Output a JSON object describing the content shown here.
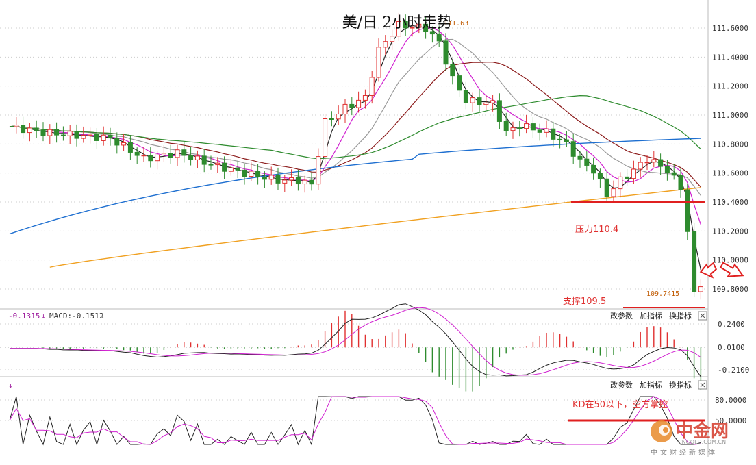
{
  "chart_data": {
    "type": "candlestick",
    "title": "美/日 2小时走势",
    "price_axis": {
      "ticks": [
        "111.6000",
        "111.4000",
        "111.2000",
        "111.0000",
        "110.8000",
        "110.6000",
        "110.4000",
        "110.2000",
        "110.0000",
        "109.8000"
      ],
      "range": [
        109.68,
        111.72
      ]
    },
    "annotations": {
      "resistance_label": "压力110.4",
      "resistance_level": 110.4,
      "support_label": "支撑109.5",
      "last_price_label": "109.7415",
      "high_label": "111.63",
      "kd_note": "KD在50以下，空方掌控"
    },
    "macd_panel": {
      "label_value": "-0.1315",
      "label_macd": "MACD:-0.1512",
      "ticks": [
        "0.2400",
        "0.0100",
        "-0.2100"
      ],
      "range": [
        -0.25,
        0.28
      ],
      "buttons": [
        "改参数",
        "加指标",
        "换指标"
      ]
    },
    "kd_panel": {
      "ticks": [
        "80.0000",
        "50.0000"
      ],
      "range": [
        5,
        95
      ],
      "buttons": [
        "改参数",
        "加指标",
        "换指标"
      ]
    },
    "colors": {
      "up": "#e03030",
      "down": "#2e8b2e",
      "ma_black": "#222222",
      "ma_magenta": "#d020d0",
      "ma_gray": "#9a9a9a",
      "ma_brown": "#8b1a1a",
      "ma_green": "#2e8b2e",
      "ma_blue": "#1e6fd0",
      "ma_orange": "#f0a020",
      "resistance": "#e02020"
    }
  },
  "watermark": {
    "brand": "中金网",
    "domain": "CNGOLD.COM.CN",
    "tagline": "中文财经新媒体"
  }
}
